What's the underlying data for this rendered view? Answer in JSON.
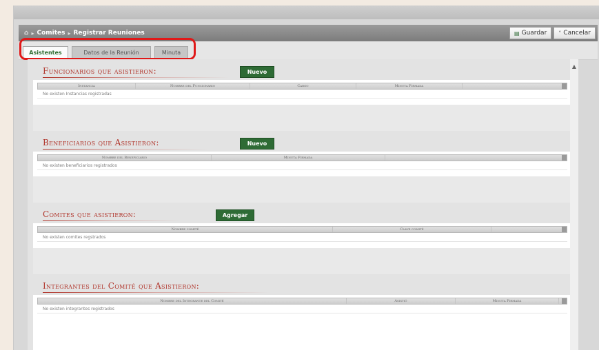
{
  "breadcrumb": {
    "items": [
      "Comites",
      "Registrar Reuniones"
    ]
  },
  "header": {
    "save_label": "Guardar",
    "cancel_label": "Cancelar"
  },
  "tabs": [
    {
      "label": "Asistentes",
      "active": true
    },
    {
      "label": "Datos de la Reunión",
      "active": false
    },
    {
      "label": "Minuta",
      "active": false
    }
  ],
  "sections": {
    "funcionarios": {
      "title": "Funcionarios que asistieron:",
      "button": "Nuevo",
      "columns": [
        "Instancia",
        "Nombre del Funcionario",
        "Cargo",
        "Minuta Firmada"
      ],
      "empty": "No existen Instancias registradas"
    },
    "beneficiarios": {
      "title": "Beneficiarios que Asistieron:",
      "button": "Nuevo",
      "columns": [
        "Nombre del Beneficiario",
        "Minuta Firmada"
      ],
      "empty": "No existen beneficiarios registrados"
    },
    "comites": {
      "title": "Comites que asistieron:",
      "button": "Agregar",
      "columns": [
        "Nombre comité",
        "Clave comité"
      ],
      "empty": "No existen comites regstrados"
    },
    "integrantes": {
      "title": "Integrantes del Comité que Asistieron:",
      "columns": [
        "Nombre del Integrante del Comité",
        "Asistió",
        "Minuta Firmada"
      ],
      "empty": "No existen integrantes registrados"
    }
  },
  "colors": {
    "accent_red": "#b0342a",
    "button_green": "#2e6b35",
    "highlight_red": "#e01818"
  },
  "icons": [
    "home-icon",
    "save-icon",
    "cancel-icon",
    "scroll-up-icon"
  ]
}
